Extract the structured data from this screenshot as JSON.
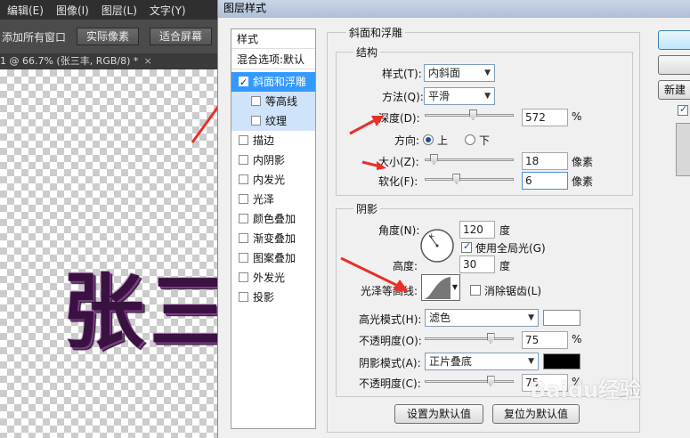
{
  "menubar": {
    "items": [
      "编辑(E)",
      "图像(I)",
      "图层(L)",
      "文字(Y)"
    ]
  },
  "options_bar": {
    "text": "添加所有窗口",
    "btn_actual": "实际像素",
    "btn_fit": "适合屏幕"
  },
  "doc_tab": {
    "label": "1 @ 66.7% (张三丰, RGB/8) *",
    "close": "×"
  },
  "canvas": {
    "text": "张三"
  },
  "dialog": {
    "title": "图层样式",
    "styles": {
      "header": "样式",
      "blend": "混合选项:默认",
      "items": [
        {
          "label": "斜面和浮雕",
          "checked": true
        },
        {
          "label": "等高线",
          "checked": false
        },
        {
          "label": "纹理",
          "checked": false
        },
        {
          "label": "描边",
          "checked": false
        },
        {
          "label": "内阴影",
          "checked": false
        },
        {
          "label": "内发光",
          "checked": false
        },
        {
          "label": "光泽",
          "checked": false
        },
        {
          "label": "颜色叠加",
          "checked": false
        },
        {
          "label": "渐变叠加",
          "checked": false
        },
        {
          "label": "图案叠加",
          "checked": false
        },
        {
          "label": "外发光",
          "checked": false
        },
        {
          "label": "投影",
          "checked": false
        }
      ]
    },
    "bevel": {
      "group_title": "斜面和浮雕",
      "structure_title": "结构",
      "style_label": "样式(T):",
      "style_value": "内斜面",
      "technique_label": "方法(Q):",
      "technique_value": "平滑",
      "depth_label": "深度(D):",
      "depth_value": "572",
      "depth_unit": "%",
      "depth_pos": 0.55,
      "direction_label": "方向:",
      "dir_up": "上",
      "dir_down": "下",
      "size_label": "大小(Z):",
      "size_value": "18",
      "size_unit": "像素",
      "size_pos": 0.1,
      "soften_label": "软化(F):",
      "soften_value": "6",
      "soften_unit": "像素",
      "soften_pos": 0.36
    },
    "shading": {
      "title": "阴影",
      "angle_label": "角度(N):",
      "angle_value": "120",
      "angle_unit": "度",
      "global_light": "使用全局光(G)",
      "altitude_label": "高度:",
      "altitude_value": "30",
      "altitude_unit": "度",
      "gloss_label": "光泽等高线:",
      "antialias": "消除锯齿(L)",
      "highlight_label": "高光模式(H):",
      "highlight_value": "滤色",
      "highlight_color": "#ffffff",
      "hl_opacity_label": "不透明度(O):",
      "hl_opacity_value": "75",
      "hl_opacity_unit": "%",
      "hl_opacity_pos": 0.75,
      "shadow_label": "阴影模式(A):",
      "shadow_value": "正片叠底",
      "shadow_color": "#000000",
      "sh_opacity_label": "不透明度(C):",
      "sh_opacity_value": "75",
      "sh_opacity_unit": "%",
      "sh_opacity_pos": 0.75
    },
    "buttons": {
      "set_default": "设置为默认值",
      "reset_default": "复位为默认值",
      "new_style": "新建"
    }
  },
  "watermark": "Baidu经验"
}
